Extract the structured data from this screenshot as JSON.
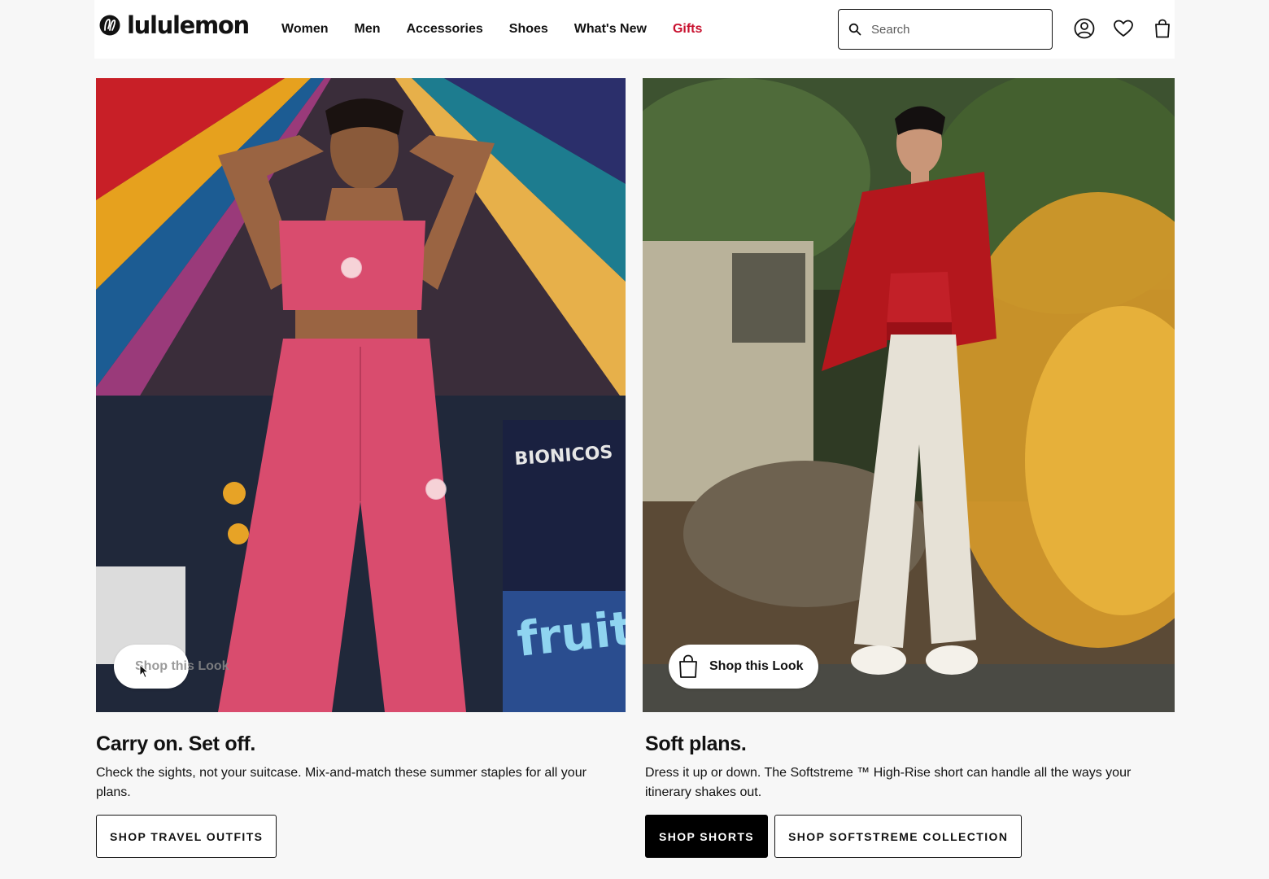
{
  "brand": {
    "name": "lululemon"
  },
  "nav": {
    "items": [
      {
        "label": "Women"
      },
      {
        "label": "Men"
      },
      {
        "label": "Accessories"
      },
      {
        "label": "Shoes"
      },
      {
        "label": "What's New"
      },
      {
        "label": "Gifts"
      }
    ]
  },
  "search": {
    "placeholder": "Search",
    "value": ""
  },
  "header_icons": [
    "account-icon",
    "wishlist-heart-icon",
    "shopping-bag-icon"
  ],
  "colors": {
    "accent_red": "#c8102e",
    "text": "#121212",
    "page_bg": "#f7f7f7",
    "button_dark": "#000000"
  },
  "promos": [
    {
      "shop_look_label": "Shop this Look",
      "title": "Carry on. Set off.",
      "description": "Check the sights, not your suitcase. Mix-and-match these summer staples for all your plans.",
      "buttons": [
        {
          "label": "SHOP TRAVEL OUTFITS",
          "style": "outline"
        }
      ]
    },
    {
      "shop_look_label": "Shop this Look",
      "title": "Soft plans.",
      "description": "Dress it up or down. The Softstreme ™ High-Rise short can handle all the ways your itinerary shakes out.",
      "buttons": [
        {
          "label": "SHOP SHORTS",
          "style": "filled"
        },
        {
          "label": "SHOP SOFTSTREME COLLECTION",
          "style": "outline"
        }
      ]
    }
  ]
}
